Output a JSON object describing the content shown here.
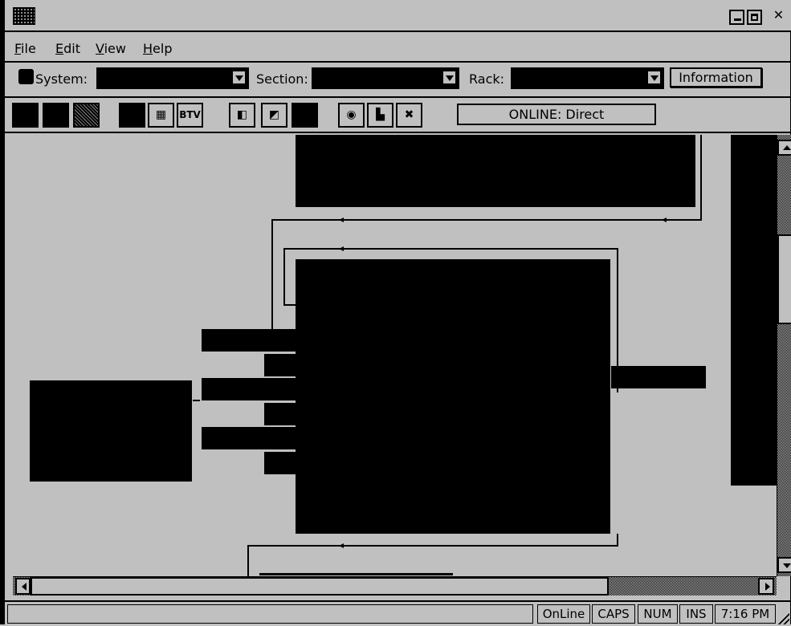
{
  "menubar": {
    "items": [
      {
        "label": "File",
        "accel": "F",
        "rest": "ile"
      },
      {
        "label": "Edit",
        "accel": "E",
        "rest": "dit"
      },
      {
        "label": "View",
        "accel": "V",
        "rest": "iew"
      },
      {
        "label": "Help",
        "accel": "H",
        "rest": "elp"
      }
    ]
  },
  "selectors": {
    "system_label": "System:",
    "system_value": "",
    "section_label": "Section:",
    "section_value": "",
    "rack_label": "Rack:",
    "rack_value": "",
    "information_label": "Information"
  },
  "toolbar": {
    "icons": [
      "tool-1-icon",
      "tool-2-icon",
      "tool-3-icon",
      "tool-4-icon",
      "grid-icon",
      "bt-icon",
      "tool-7-icon",
      "tool-8-icon",
      "tool-9-icon",
      "tool-10-icon",
      "tool-11-icon",
      "tool-12-icon"
    ],
    "bt_glyph": "BTV",
    "status_text": "ONLINE: Direct"
  },
  "statusbar": {
    "message": "",
    "online": "OnLine",
    "caps": "CAPS",
    "num": "NUM",
    "ins": "INS",
    "time": "7:16 PM"
  },
  "colors": {
    "face": "#c0c0c0",
    "ink": "#000000"
  }
}
